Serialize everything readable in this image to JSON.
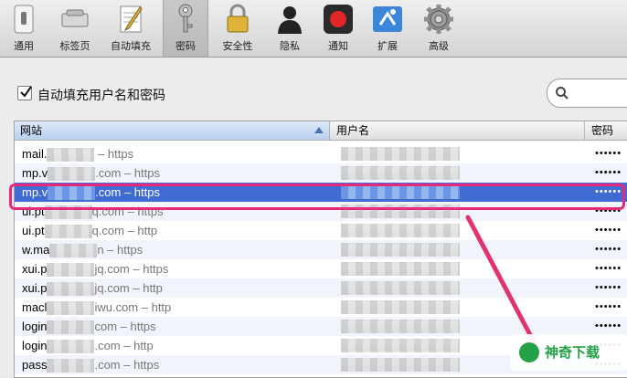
{
  "toolbar": {
    "items": [
      {
        "label": "通用",
        "icon": "switch-icon"
      },
      {
        "label": "标签页",
        "icon": "tabs-icon"
      },
      {
        "label": "自动填充",
        "icon": "pencil-notepad-icon"
      },
      {
        "label": "密码",
        "icon": "key-icon",
        "selected": true
      },
      {
        "label": "安全性",
        "icon": "padlock-icon"
      },
      {
        "label": "隐私",
        "icon": "silhouette-icon"
      },
      {
        "label": "通知",
        "icon": "red-record-icon"
      },
      {
        "label": "扩展",
        "icon": "puzzle-icon"
      },
      {
        "label": "高级",
        "icon": "gear-icon"
      }
    ]
  },
  "autofill": {
    "label": "自动填充用户名和密码",
    "checked": true
  },
  "table": {
    "headers": {
      "site": "网站",
      "user": "用户名",
      "password": "密码"
    },
    "rows": [
      {
        "site": "mail.",
        "proto": " – https",
        "password": "••••••"
      },
      {
        "site": "mp.v",
        "proto": ".com – https",
        "password": "••••••"
      },
      {
        "site": "mp.v",
        "proto": ".com – https",
        "password": "••••••",
        "selected": true
      },
      {
        "site": "ui.pt",
        "proto": "q.com – https",
        "password": "••••••"
      },
      {
        "site": "ui.pt",
        "proto": "q.com – http",
        "password": "••••••"
      },
      {
        "site": "w.ma",
        "proto": "n – https",
        "password": "••••••"
      },
      {
        "site": "xui.p",
        "proto": "jq.com – https",
        "password": "••••••"
      },
      {
        "site": "xui.p",
        "proto": "jq.com – http",
        "password": "••••••"
      },
      {
        "site": "macl",
        "proto": "iwu.com – http",
        "password": "••••••"
      },
      {
        "site": "login",
        "proto": "com – https",
        "password": "••••••"
      },
      {
        "site": "login",
        "proto": ".com – http",
        "password": "••••••"
      },
      {
        "site": "pass",
        "proto": ".com – https",
        "password": "••••••"
      }
    ]
  },
  "colors": {
    "selection": "#3f6bd2",
    "annotation": "#e62a7a",
    "watermark": "#25a146"
  },
  "watermark": {
    "text": "神奇下载"
  }
}
